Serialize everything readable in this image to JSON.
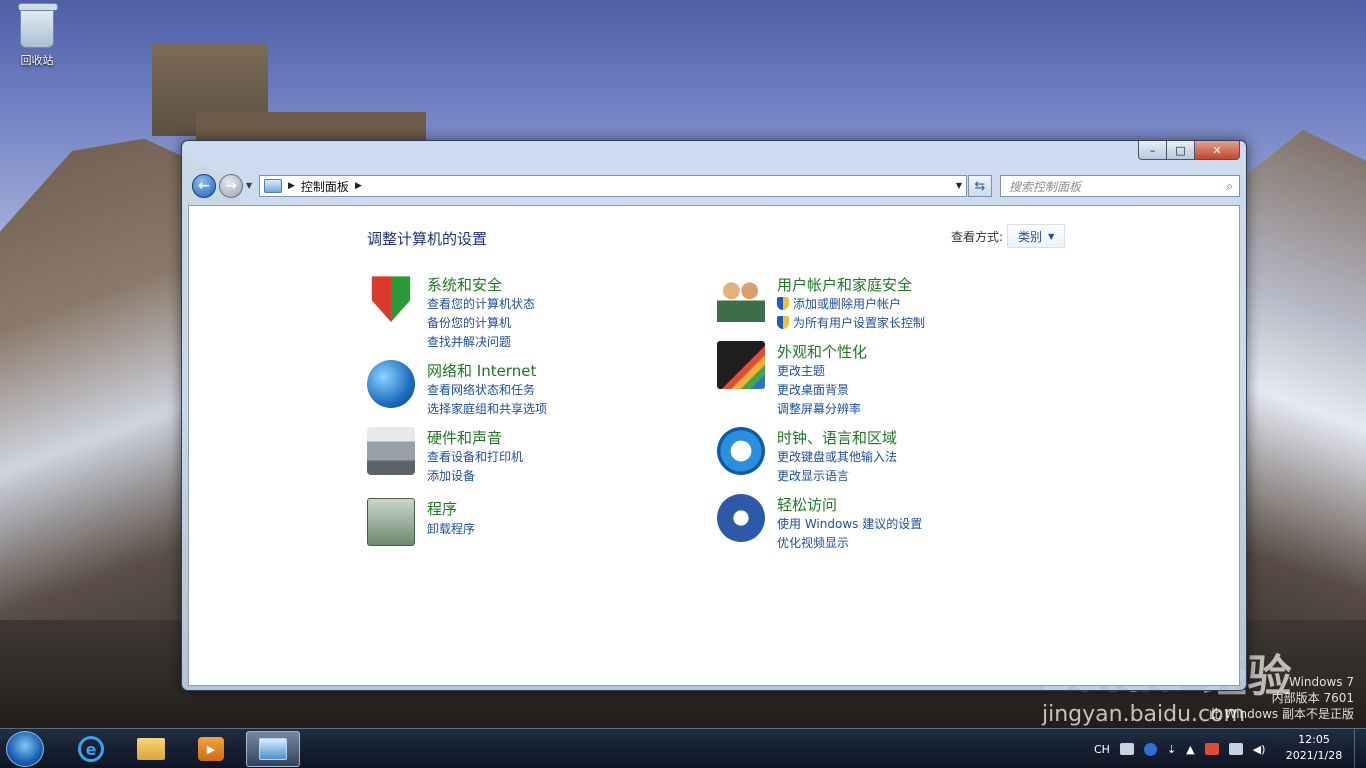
{
  "desktop": {
    "icons": [
      {
        "label": "回收站"
      }
    ],
    "watermark": {
      "logo": "Baidu 经验",
      "url": "jingyan.baidu.com",
      "win_line1": "Windows 7",
      "win_line2": "内部版本 7601",
      "win_line3": "此 Windows 副本不是正版"
    }
  },
  "window": {
    "controls": {
      "minimize": "–",
      "maximize": "□",
      "close": "✕"
    },
    "address": {
      "crumbs": [
        "控制面板"
      ]
    },
    "search": {
      "placeholder": "搜索控制面板"
    },
    "content": {
      "title": "调整计算机的设置",
      "view_by_label": "查看方式:",
      "view_by_value": "类别",
      "categories_left": [
        {
          "title": "系统和安全",
          "icon": "shield-icon",
          "links": [
            "查看您的计算机状态",
            "备份您的计算机",
            "查找并解决问题"
          ]
        },
        {
          "title": "网络和 Internet",
          "icon": "network-globe-icon",
          "links": [
            "查看网络状态和任务",
            "选择家庭组和共享选项"
          ]
        },
        {
          "title": "硬件和声音",
          "icon": "printer-icon",
          "links": [
            "查看设备和打印机",
            "添加设备"
          ]
        },
        {
          "title": "程序",
          "icon": "programs-icon",
          "links": [
            "卸载程序"
          ]
        }
      ],
      "categories_right": [
        {
          "title": "用户帐户和家庭安全",
          "icon": "users-icon",
          "links": [
            "添加或删除用户帐户",
            "为所有用户设置家长控制"
          ]
        },
        {
          "title": "外观和个性化",
          "icon": "monitor-icon",
          "links": [
            "更改主题",
            "更改桌面背景",
            "调整屏幕分辨率"
          ]
        },
        {
          "title": "时钟、语言和区域",
          "icon": "clock-globe-icon",
          "links": [
            "更改键盘或其他输入法",
            "更改显示语言"
          ]
        },
        {
          "title": "轻松访问",
          "icon": "ease-of-access-icon",
          "links": [
            "使用 Windows 建议的设置",
            "优化视频显示"
          ]
        }
      ]
    }
  },
  "taskbar": {
    "tray": {
      "lang": "CH"
    },
    "clock": {
      "time": "12:05",
      "date": "2021/1/28"
    }
  }
}
